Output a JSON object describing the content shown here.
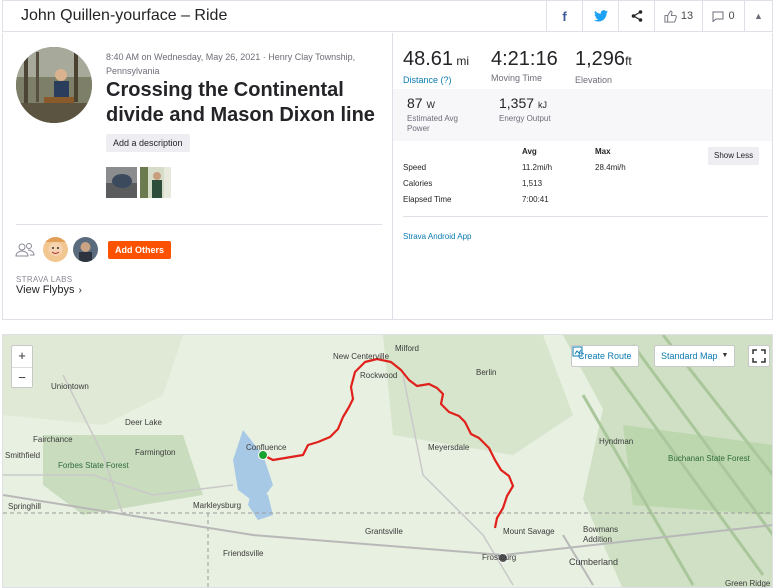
{
  "header": {
    "title": "John Quillen-yourface – Ride",
    "kudos_count": "13",
    "comment_count": "0",
    "icons": [
      "facebook-icon",
      "twitter-icon",
      "share-icon",
      "thumbs-up-icon",
      "comment-icon",
      "collapse-icon"
    ]
  },
  "activity": {
    "datetime_location": "8:40 AM on Wednesday, May 26, 2021 · Henry Clay Township, Pennsylvania",
    "title": "Crossing the Continental divide and Mason Dixon line",
    "add_description_label": "Add a description",
    "add_others_label": "Add Others",
    "labs_label": "STRAVA LABS",
    "flybys_label": "View Flybys"
  },
  "stats": {
    "distance": {
      "value": "48.61",
      "unit": "mi",
      "label": "Distance (?)"
    },
    "moving_time": {
      "value": "4:21:16",
      "label": "Moving Time"
    },
    "elevation": {
      "value": "1,296",
      "unit": "ft",
      "label": "Elevation"
    },
    "power": {
      "value": "87",
      "unit": "W",
      "label": "Estimated Avg Power"
    },
    "energy": {
      "value": "1,357",
      "unit": "kJ",
      "label": "Energy Output"
    }
  },
  "table": {
    "headers": {
      "avg": "Avg",
      "max": "Max"
    },
    "show_less_label": "Show Less",
    "rows": [
      {
        "label": "Speed",
        "avg": "11.2mi/h",
        "max": "28.4mi/h"
      },
      {
        "label": "Calories",
        "avg": "1,513",
        "max": ""
      },
      {
        "label": "Elapsed Time",
        "avg": "7:00:41",
        "max": ""
      }
    ]
  },
  "device": "Strava Android App",
  "map": {
    "create_route_label": "Create Route",
    "map_type_label": "Standard Map",
    "zoom_in": "+",
    "zoom_out": "−",
    "route_color": "#e0201b",
    "towns": [
      "Milford",
      "New Centerville",
      "Uniontown",
      "Rockwood",
      "Berlin",
      "Deer Lake",
      "Fairchance",
      "Confluence",
      "Smithfield",
      "Farmington",
      "Meyersdale",
      "Hyndman",
      "Forbes State Forest",
      "Buchanan State Forest",
      "Markleysburg",
      "Springhill",
      "Grantsville",
      "Mount Savage",
      "Bowmans Addition",
      "Friendsville",
      "Frostburg",
      "Cumberland",
      "Green Ridge"
    ]
  }
}
